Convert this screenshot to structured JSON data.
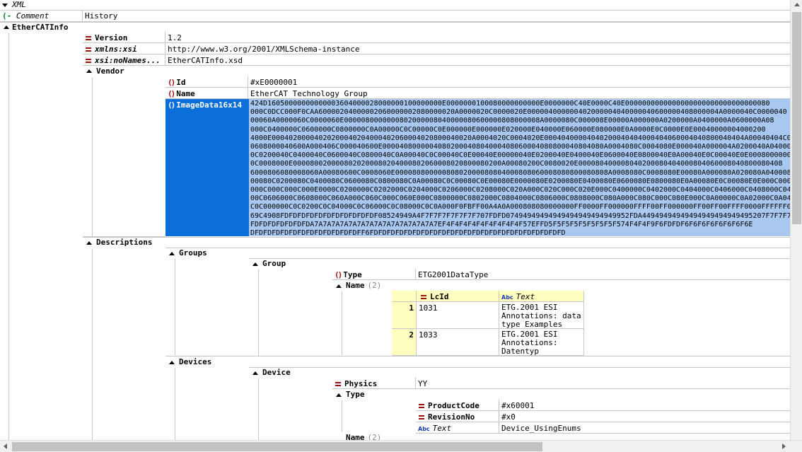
{
  "root": {
    "xml_label": "XML",
    "comment_label": "Comment",
    "comment_value": "History"
  },
  "ethercat": {
    "label": "EtherCATInfo",
    "attrs": [
      {
        "name": "Version",
        "value": "1.2"
      },
      {
        "name": "xmlns:xsi",
        "value": "http://www.w3.org/2001/XMLSchema-instance"
      },
      {
        "name": "xsi:noNames...",
        "value": "EtherCATInfo.xsd"
      }
    ]
  },
  "vendor": {
    "label": "Vendor",
    "id": {
      "name": "Id",
      "value": "#xE0000001"
    },
    "name": {
      "name": "Name",
      "value": "EtherCAT Technology Group"
    },
    "image": {
      "name": "ImageData16x14",
      "lines": [
        "424D16050000000000003604000028000000100000000E0000000100080000000000E0000000C40E0000C40E0000000000000000000000000000000080",
        "000C0DCC000F0CAA60000204000002060000002080000020A0000020C0000020E000004000000402000004040000040600000408000004A0000040C0000040",
        "00060A0000060C0000060E0000080000000802000008040000080600000808000008A0000080C000008E00000A000000A0200000A0400000A0600000A08",
        "000C0400000C0600000C0800000C0A00000C0C00000C0E000000E000000E020000E040000E060000E080000E0A0000E0C0000E0E00040000004000200",
        "4000E00040200004020200040204000402060004020800040020A0004020C0004020E00040400004040200040404000404060004040800040404A00040404C00",
        "0608000040600A000406C000040600E0000408000004080200040804000408060004080800040804080A0004080C0004080E000040A000004A0200040A04000A060",
        "0C0200040C0400040C0600040C0800040C0A00040C0C00040C0E00040E00000040E0200040E0400040E0600040E0800040E0A00040E0C00040E0E00080000000080",
        "0C0008000E0000800200008020200080204000802060008020800080200A00080200C0080020E000080400008040200080404000804060008040800080408",
        "6000806080008060A00080600C0008060E00008080000080802000080804000808060008080800080808A0008080C0008080E00080A000080A020080A04000800A",
        "00080C0200080C0400080C0600080C0800080C0A00080C0C00080C0E00080E0000080E0200080E0400080E0600080E0800080E0A00080E0C00080E0E000C000C",
        "000C000C000C000E0000C0200000C0202000C0204000C0206000C0208000C020A000C020C000C020E000C0400000C0402000C0404000C0406000C0408000C040A",
        "00C0606000C0608000C060A000C060C000C060E000C0800000C0802000C0804000C0806000C0808000C080A000C080C000C080E000C0A00000C0A02000C0A040",
        "C0C000000C0C0200C0C04000C0C06000C0C08000C0C0A000F0FBFF00A4A0A000808080000000FF0000FF000000FFFF00FF000000FF00FF00FFFF0000FFFFFF0",
        "69C4908FDFDFDFDFDFDFDFDFDFDFDF08524949A4F7F7F7F7F7F7F707FDFD07494949494949494949494949952FDA44949494949494949494949495207F7F7F7",
        "FDFDFDFDFDFDFDA7A7A7A7A7A7A7A7A7A7A7A7A7A7A7EF4F4F4F4F4F4F4F4F4F57EFFD5F5F5F5F5F5F5F5F574F4F4F9F6FDFDF6F6F6F6F6F6F6F6E",
        "DFDFDFDFDFDFDFDFDFDFDFDFDFF6FDFDFDFDFDFDFDFDFDFDFDFDFDFDFDFDFDFDFDFDFDFDFD"
      ]
    }
  },
  "descriptions": {
    "label": "Descriptions",
    "groups_label": "Groups",
    "group_label": "Group",
    "group_type": {
      "name": "Type",
      "value": "ETG2001DataType"
    },
    "group_name": {
      "name": "Name",
      "count": "(2)"
    },
    "lc_header": {
      "lcid": "LcId",
      "text": "Text"
    },
    "lc_rows": [
      {
        "idx": "1",
        "lcid": "1031",
        "text": [
          "ETG.2001 ESI",
          "Annotations: data",
          "type Examples"
        ]
      },
      {
        "idx": "2",
        "lcid": "1033",
        "text": [
          "ETG.2001 ESI",
          "Annotations:",
          "Datentyp Beispiele"
        ]
      }
    ],
    "devices_label": "Devices",
    "device_label": "Device",
    "physics": {
      "name": "Physics",
      "value": "YY"
    },
    "type_label": "Type",
    "product_code": {
      "name": "ProductCode",
      "value": "#x60001"
    },
    "revision_no": {
      "name": "RevisionNo",
      "value": "#x0"
    },
    "type_text": {
      "name": "Text",
      "value": "Device_UsingEnums"
    },
    "name2": {
      "name": "Name",
      "count": "(2)"
    }
  }
}
